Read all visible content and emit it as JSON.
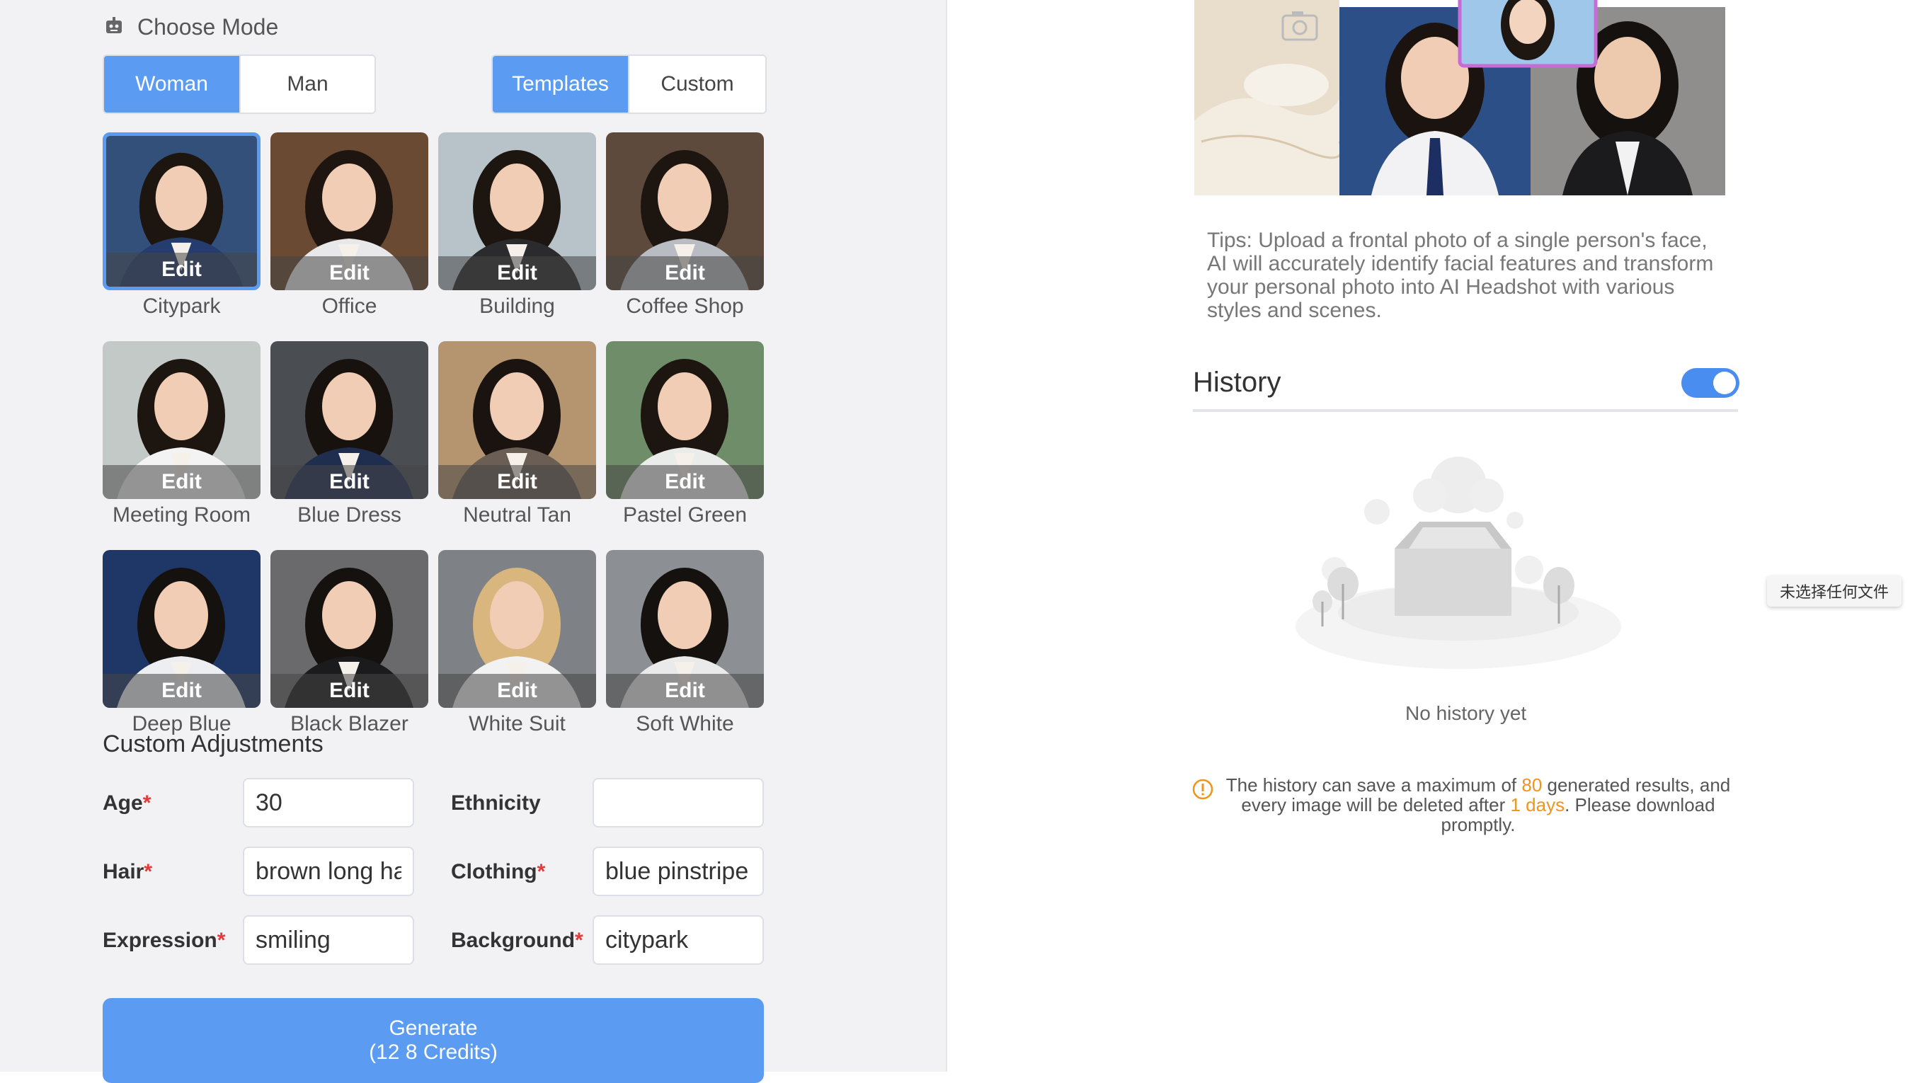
{
  "header": {
    "title": "Choose Mode",
    "icon": "robot-icon"
  },
  "gender_tabs": [
    {
      "label": "Woman",
      "active": true
    },
    {
      "label": "Man",
      "active": false
    }
  ],
  "mode_tabs": [
    {
      "label": "Templates",
      "active": true
    },
    {
      "label": "Custom",
      "active": false
    }
  ],
  "templates": [
    {
      "name": "Citypark",
      "edit": "Edit",
      "selected": true,
      "bg": "#33507a",
      "hair": "#1c1510",
      "cloth": "#243c6e"
    },
    {
      "name": "Office",
      "edit": "Edit",
      "selected": false,
      "bg": "#6b4a34",
      "hair": "#1e1510",
      "cloth": "#e8e8ea"
    },
    {
      "name": "Building",
      "edit": "Edit",
      "selected": false,
      "bg": "#b7c2c9",
      "hair": "#1c1510",
      "cloth": "#2b2b2e"
    },
    {
      "name": "Coffee Shop",
      "edit": "Edit",
      "selected": false,
      "bg": "#5d4a3c",
      "hair": "#1c1510",
      "cloth": "#b9bcc2"
    },
    {
      "name": "Meeting Room",
      "edit": "Edit",
      "selected": false,
      "bg": "#c3c9c6",
      "hair": "#1c1510",
      "cloth": "#f3f3f3"
    },
    {
      "name": "Blue Dress",
      "edit": "Edit",
      "selected": false,
      "bg": "#4a4d52",
      "hair": "#18120f",
      "cloth": "#1f2d4f"
    },
    {
      "name": "Neutral Tan",
      "edit": "Edit",
      "selected": false,
      "bg": "#b59470",
      "hair": "#1a130f",
      "cloth": "#6b5e54"
    },
    {
      "name": "Pastel Green",
      "edit": "Edit",
      "selected": false,
      "bg": "#6f8d68",
      "hair": "#1c1510",
      "cloth": "#e9ece8"
    },
    {
      "name": "Deep Blue",
      "edit": "Edit",
      "selected": false,
      "bg": "#1f3766",
      "hair": "#15110e",
      "cloth": "#eceef2"
    },
    {
      "name": "Black Blazer",
      "edit": "Edit",
      "selected": false,
      "bg": "#6a6a6c",
      "hair": "#15110e",
      "cloth": "#1b1b1d"
    },
    {
      "name": "White Suit",
      "edit": "Edit",
      "selected": false,
      "bg": "#7e8186",
      "hair": "#d8b67d",
      "cloth": "#f2f2f2"
    },
    {
      "name": "Soft White",
      "edit": "Edit",
      "selected": false,
      "bg": "#8c8f93",
      "hair": "#15110e",
      "cloth": "#eaeaea"
    }
  ],
  "custom": {
    "title": "Custom Adjustments",
    "required_mark": "*",
    "age": {
      "label": "Age",
      "value": "30",
      "required": true
    },
    "ethnicity": {
      "label": "Ethnicity",
      "value": "",
      "required": false
    },
    "hair": {
      "label": "Hair",
      "value": "brown long ha",
      "required": true
    },
    "clothing": {
      "label": "Clothing",
      "value": "blue pinstripe",
      "required": true
    },
    "expression": {
      "label": "Expression",
      "value": "smiling",
      "required": true
    },
    "background": {
      "label": "Background",
      "value": "citypark",
      "required": true
    }
  },
  "generate": {
    "line1": "Generate",
    "line2": "(12 8 Credits)"
  },
  "tips": "Tips: Upload a frontal photo of a single person's face, AI will accurately identify facial features and transform your personal photo into AI Headshot with various styles and scenes.",
  "history": {
    "title": "History",
    "toggle_on": true,
    "empty_text": "No history yet",
    "notice_before": "The history can save a maximum of ",
    "notice_count": "80",
    "notice_middle": " generated results, and every image will be deleted after ",
    "notice_days": "1 days",
    "notice_after": ". Please download promptly."
  },
  "file_input_text": "未选择任何文件",
  "colors": {
    "accent": "#5b9cf2",
    "toggle": "#4a8df0",
    "warning": "#f0941c",
    "required": "#e23b3b"
  }
}
